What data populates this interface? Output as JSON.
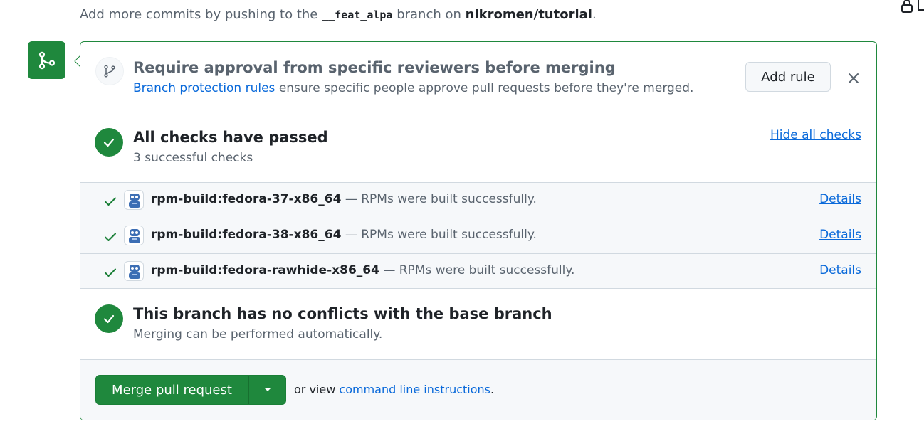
{
  "top": {
    "prefix": "Add more commits by pushing to the",
    "branch": "__feat_alpa",
    "middle": "branch on",
    "repo": "nikromen/tutorial",
    "suffix": "."
  },
  "review": {
    "title": "Require approval from specific reviewers before merging",
    "link_text": "Branch protection rules",
    "subtitle_rest": "ensure specific people approve pull requests before they're merged.",
    "add_rule_label": "Add rule"
  },
  "checks": {
    "title": "All checks have passed",
    "subtitle": "3 successful checks",
    "hide_label": "Hide all checks",
    "rows": [
      {
        "name": "rpm-build:fedora-37-x86_64",
        "desc": "— RPMs were built successfully.",
        "details": "Details"
      },
      {
        "name": "rpm-build:fedora-38-x86_64",
        "desc": "— RPMs were built successfully.",
        "details": "Details"
      },
      {
        "name": "rpm-build:fedora-rawhide-x86_64",
        "desc": "— RPMs were built successfully.",
        "details": "Details"
      }
    ]
  },
  "conflicts": {
    "title": "This branch has no conflicts with the base branch",
    "subtitle": "Merging can be performed automatically."
  },
  "merge": {
    "button_label": "Merge pull request",
    "or_view": "or view",
    "cli_link": "command line instructions",
    "cli_suffix": "."
  },
  "colors": {
    "success": "#1f883d",
    "link": "#0969da",
    "muted": "#59636e"
  }
}
